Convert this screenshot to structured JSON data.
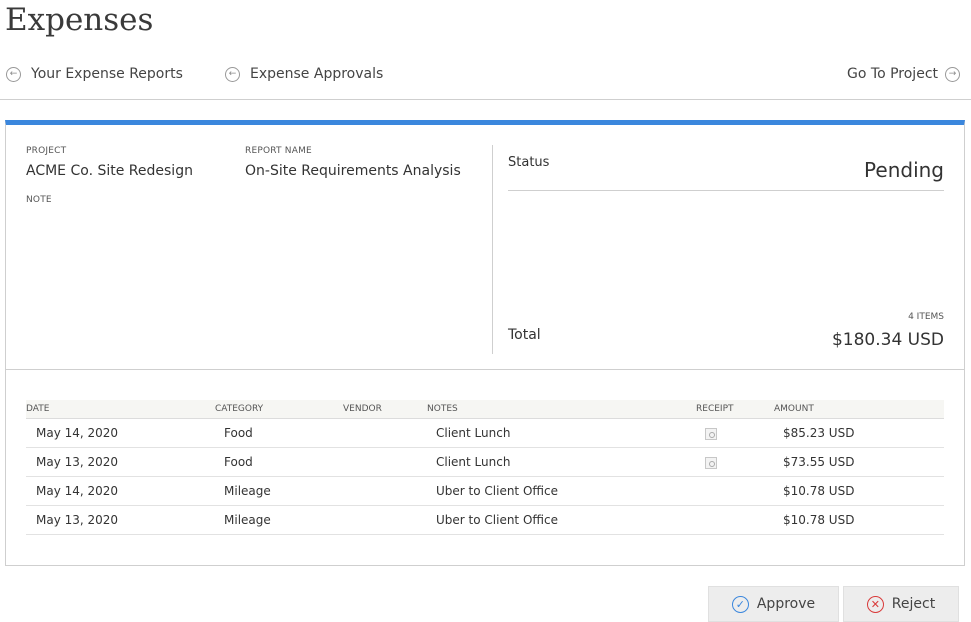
{
  "page": {
    "title": "Expenses"
  },
  "nav": {
    "reports_label": "Your Expense Reports",
    "approvals_label": "Expense Approvals",
    "project_label": "Go To Project"
  },
  "report": {
    "project_label": "PROJECT",
    "project_value": "ACME Co. Site Redesign",
    "report_name_label": "REPORT NAME",
    "report_name_value": "On-Site Requirements Analysis",
    "note_label": "NOTE",
    "status_label": "Status",
    "status_value": "Pending",
    "items_count": "4 ITEMS",
    "total_label": "Total",
    "total_value": "$180.34 USD"
  },
  "table": {
    "headers": {
      "date": "DATE",
      "category": "CATEGORY",
      "vendor": "VENDOR",
      "notes": "NOTES",
      "receipt": "RECEIPT",
      "amount": "AMOUNT"
    },
    "rows": [
      {
        "date": "May 14, 2020",
        "category": "Food",
        "vendor": "",
        "notes": "Client Lunch",
        "receipt": true,
        "amount": "$85.23 USD"
      },
      {
        "date": "May 13, 2020",
        "category": "Food",
        "vendor": "",
        "notes": "Client Lunch",
        "receipt": true,
        "amount": "$73.55 USD"
      },
      {
        "date": "May 14, 2020",
        "category": "Mileage",
        "vendor": "",
        "notes": "Uber to Client Office",
        "receipt": false,
        "amount": "$10.78 USD"
      },
      {
        "date": "May 13, 2020",
        "category": "Mileage",
        "vendor": "",
        "notes": "Uber to Client Office",
        "receipt": false,
        "amount": "$10.78 USD"
      }
    ]
  },
  "actions": {
    "approve_label": "Approve",
    "reject_label": "Reject"
  },
  "colors": {
    "accent": "#3b87dd",
    "reject": "#d93a3a"
  }
}
